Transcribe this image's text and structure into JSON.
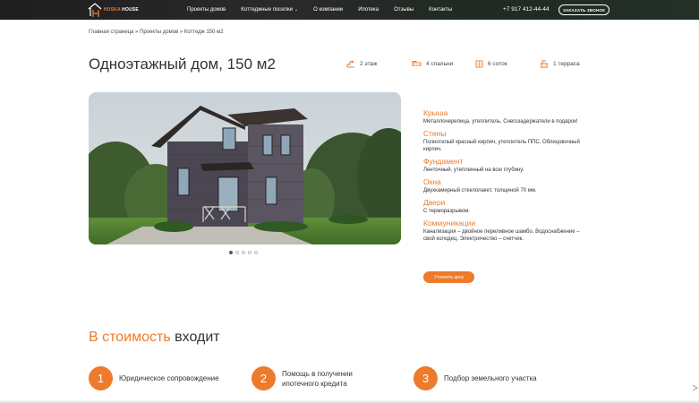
{
  "header": {
    "logo": {
      "part1": "HUSKA",
      "part2": " HOUSE"
    },
    "nav": [
      {
        "label": "Проекты домов"
      },
      {
        "label": "Коттеджные поселки",
        "has_dropdown": true
      },
      {
        "label": "О компании"
      },
      {
        "label": "Ипотека"
      },
      {
        "label": "Отзывы"
      },
      {
        "label": "Контакты"
      }
    ],
    "phone": "+7 917 412-44-44",
    "call_button": "ЗАКАЗАТЬ ЗВОНОК"
  },
  "breadcrumb": "Главная страница » Проекты домов » Коттедж 150 м2",
  "title": "Одноэтажный дом, 150 м2",
  "features": [
    {
      "icon": "floors-icon",
      "label": "2 этаж"
    },
    {
      "icon": "bed-icon",
      "label": "4 спальни"
    },
    {
      "icon": "plot-icon",
      "label": "6 соток"
    },
    {
      "icon": "terrace-icon",
      "label": "1 терраса"
    }
  ],
  "gallery": {
    "slides": 5,
    "active": 0
  },
  "specs": [
    {
      "title": "Крыша",
      "text": "Металлочерепица, утеплитель. Снегозадержатели в подарок!"
    },
    {
      "title": "Стены",
      "text": "Полнотелый красный кирпич, утеплитель ППС. Облицовочный кирпич."
    },
    {
      "title": "Фундамент",
      "text": "Ленточный, утепленный на всю глубину."
    },
    {
      "title": "Окна",
      "text": "Двухкамерный стеклопакет, толщиной 70 мм."
    },
    {
      "title": "Двери",
      "text": "С терморазрывом."
    },
    {
      "title": "Коммуникации",
      "text": "Канализация – двойное переливное шамбо. Водоснабжение – свой колодец. Электричество – счетчик."
    }
  ],
  "price_button": "Уточнить цену",
  "cost": {
    "title_accent": "В стоимость",
    "title_rest": " входит",
    "steps": [
      {
        "num": "1",
        "text": "Юридическое сопровождение"
      },
      {
        "num": "2",
        "text": "Помощь в получении ипотечного кредита"
      },
      {
        "num": "3",
        "text": "Подбор земельного участка"
      }
    ]
  },
  "colors": {
    "accent": "#ee7a2b",
    "header_bg": "#1e1e1e",
    "text": "#333333"
  }
}
